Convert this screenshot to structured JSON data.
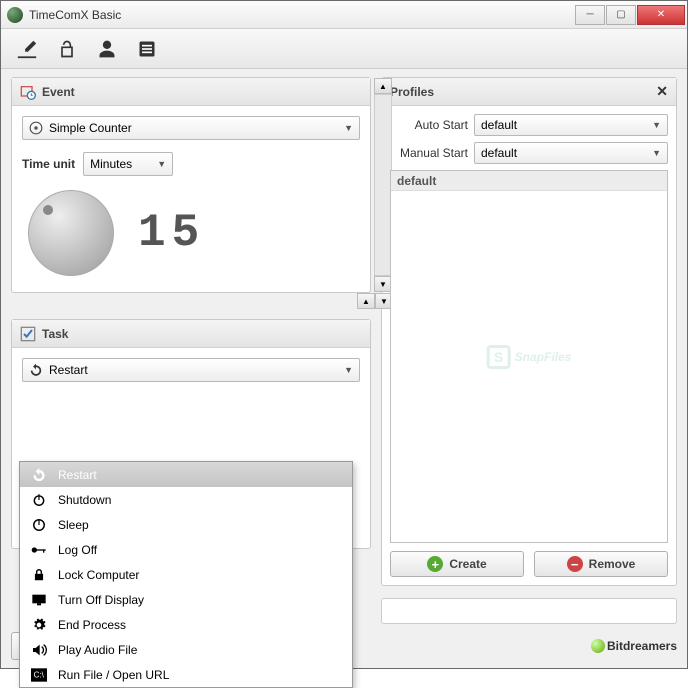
{
  "window": {
    "title": "TimeComX Basic"
  },
  "event": {
    "header": "Event",
    "type_label": "Simple Counter",
    "time_unit_label": "Time unit",
    "time_unit_value": "Minutes",
    "counter_value": "15"
  },
  "task": {
    "header": "Task",
    "selected": "Restart",
    "options": [
      "Restart",
      "Shutdown",
      "Sleep",
      "Log Off",
      "Lock Computer",
      "Turn Off Display",
      "End Process",
      "Play Audio File",
      "Run File / Open URL"
    ]
  },
  "profiles": {
    "header": "Profiles",
    "auto_start_label": "Auto Start",
    "auto_start_value": "default",
    "manual_start_label": "Manual Start",
    "manual_start_value": "default",
    "list": [
      "default"
    ],
    "create_label": "Create",
    "remove_label": "Remove"
  },
  "watermark": "SnapFiles",
  "footer_brand": "Bitdreamers"
}
